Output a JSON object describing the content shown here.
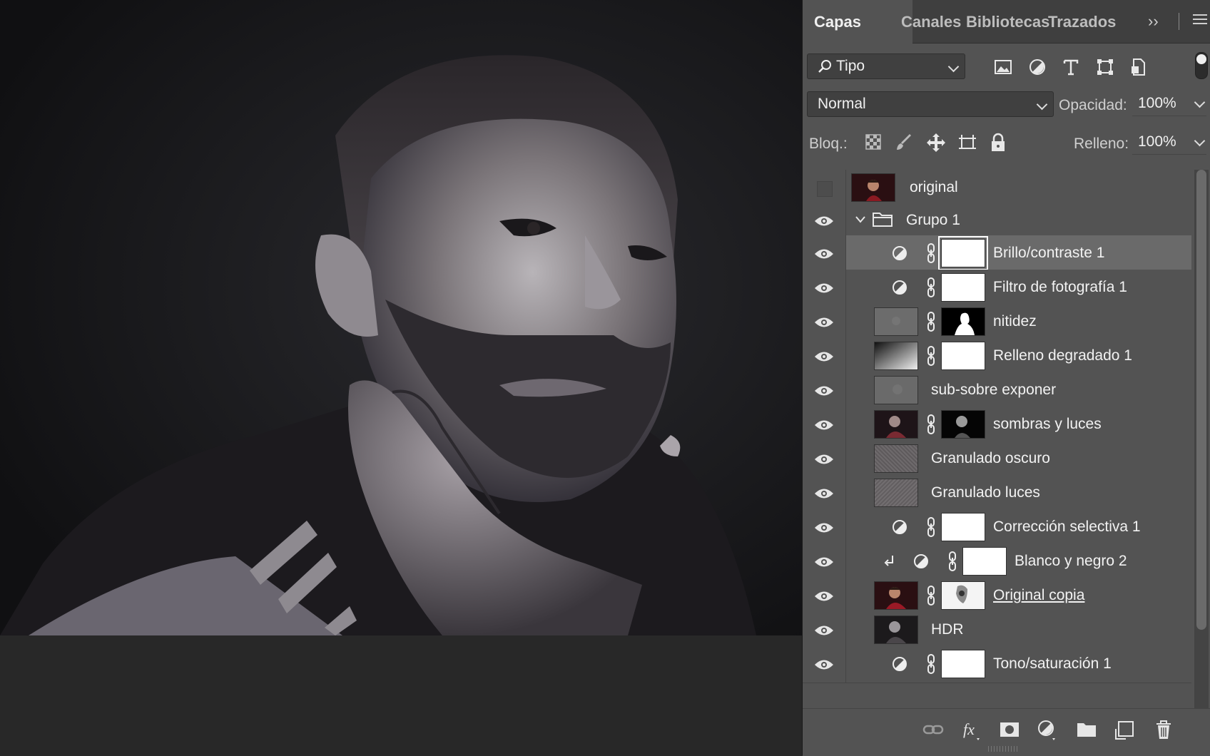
{
  "panel": {
    "tabs": [
      {
        "label": "Capas",
        "active": true
      },
      {
        "label": "Canales",
        "active": false
      },
      {
        "label": "Bibliotecas",
        "active": false
      },
      {
        "label": "Trazados",
        "active": false
      }
    ],
    "collapse_icon": "double-chevron-right-icon",
    "menu_icon": "hamburger-menu-icon"
  },
  "filter": {
    "kind_label": "Tipo",
    "icons": [
      "image-filter-icon",
      "adjustment-filter-icon",
      "type-filter-icon",
      "shape-filter-icon",
      "smart-object-filter-icon"
    ]
  },
  "blend": {
    "mode": "Normal",
    "opacity_label": "Opacidad:",
    "opacity_value": "100%"
  },
  "lock": {
    "label": "Bloq.:",
    "icons": [
      "lock-transparent-pixels-icon",
      "lock-image-pixels-icon",
      "lock-position-icon",
      "lock-artboard-icon",
      "lock-all-icon"
    ],
    "fill_label": "Relleno:",
    "fill_value": "100%"
  },
  "layers": [
    {
      "name": "original",
      "visible": false,
      "type": "pixel"
    },
    {
      "name": "Grupo 1",
      "visible": true,
      "type": "group"
    },
    {
      "name": "Brillo/contraste 1",
      "visible": true,
      "type": "adjustment",
      "selected": true
    },
    {
      "name": "Filtro de fotografía 1",
      "visible": true,
      "type": "adjustment"
    },
    {
      "name": "nitidez",
      "visible": true,
      "type": "masked-pixel"
    },
    {
      "name": "Relleno degradado 1",
      "visible": true,
      "type": "gradient"
    },
    {
      "name": "sub-sobre exponer",
      "visible": true,
      "type": "pixel"
    },
    {
      "name": "sombras y luces",
      "visible": true,
      "type": "masked-pixel"
    },
    {
      "name": "Granulado oscuro",
      "visible": true,
      "type": "noise"
    },
    {
      "name": "Granulado luces",
      "visible": true,
      "type": "noise"
    },
    {
      "name": "Corrección selectiva 1",
      "visible": true,
      "type": "adjustment"
    },
    {
      "name": "Blanco y negro 2",
      "visible": true,
      "type": "adjustment-clipped"
    },
    {
      "name": "Original copia",
      "visible": true,
      "type": "masked-pixel",
      "underlined": true
    },
    {
      "name": "HDR",
      "visible": true,
      "type": "pixel"
    },
    {
      "name": "Tono/saturación 1",
      "visible": true,
      "type": "adjustment"
    }
  ],
  "bottom_icons": [
    "link-layers-icon",
    "fx-icon",
    "add-mask-icon",
    "new-adjustment-icon",
    "new-group-icon",
    "new-layer-icon",
    "delete-layer-icon"
  ]
}
